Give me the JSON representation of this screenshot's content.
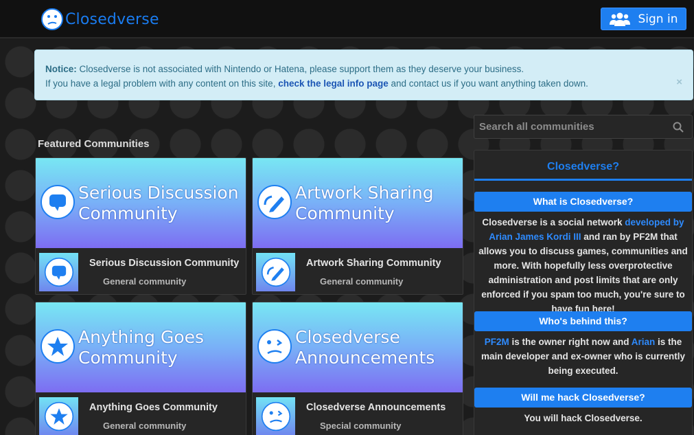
{
  "header": {
    "logo_text": "Closedverse",
    "signin_label": "Sign in"
  },
  "notice": {
    "prefix": "Notice:",
    "line1": " Closedverse is not associated with Nintendo or Hatena, please support them as they deserve your business.",
    "line2_start": "If you have a legal problem with any content on this site, ",
    "link_text": "check the legal info page",
    "line2_end": " and contact us if you want anything taken down.",
    "close": "×"
  },
  "featured": {
    "title": "Featured Communities",
    "cards": [
      {
        "banner_line1": "Serious Discussion",
        "banner_line2": "Community",
        "name": "Serious Discussion Community",
        "type": "General community",
        "icon": "chat-bubble-icon"
      },
      {
        "banner_line1": "Artwork Sharing",
        "banner_line2": "Community",
        "name": "Artwork Sharing Community",
        "type": "General community",
        "icon": "pencil-icon"
      },
      {
        "banner_line1": "Anything Goes",
        "banner_line2": "Community",
        "name": "Anything Goes Community",
        "type": "General community",
        "icon": "star-icon"
      },
      {
        "banner_line1": "Closedverse",
        "banner_line2": "Announcements",
        "name": "Closedverse Announcements",
        "type": "Special community",
        "icon": "confused-face-icon"
      }
    ]
  },
  "search": {
    "placeholder": "Search all communities"
  },
  "sidebar": {
    "title": "Closedverse?",
    "sections": [
      {
        "heading": "What is Closedverse?",
        "text_before": "Closedverse is a social network ",
        "link": "developed by Arian James Kordi III",
        "text_after": " and ran by PF2M that allows you to discuss games, communities and more. With hopefully less overprotective administration and post limits that are only enforced if you spam too much, you're sure to have fun here!"
      },
      {
        "heading": "Who's behind this?",
        "link1": "PF2M",
        "text_middle": " is the owner right now and ",
        "link2": "Arian",
        "text_after": " is the main developer and ex-owner who is currently being executed."
      },
      {
        "heading": "Will me hack Closedverse?",
        "text": "You will hack Closedverse."
      }
    ]
  },
  "colors": {
    "accent": "#1e7ff0",
    "background": "#1c1c1c",
    "notice_bg": "#d3edf6"
  }
}
